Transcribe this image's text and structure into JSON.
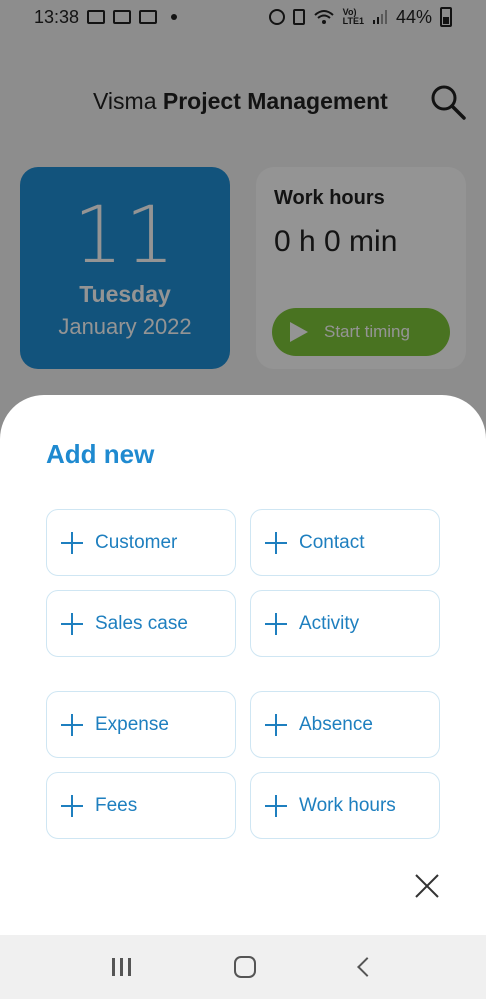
{
  "status_bar": {
    "time": "13:38",
    "battery": "44%"
  },
  "header": {
    "brand_light": "Visma",
    "brand_bold": "Project Management",
    "search_icon": "search-icon"
  },
  "date_card": {
    "day": "11",
    "weekday": "Tuesday",
    "month_year": "January 2022"
  },
  "work_card": {
    "title": "Work hours",
    "value": "0 h 0 min",
    "start_label": "Start timing"
  },
  "sheet": {
    "title": "Add new",
    "items": [
      {
        "label": "Customer"
      },
      {
        "label": "Contact"
      },
      {
        "label": "Sales case"
      },
      {
        "label": "Activity"
      },
      {
        "label": "Expense"
      },
      {
        "label": "Absence"
      },
      {
        "label": "Fees"
      },
      {
        "label": "Work hours"
      }
    ],
    "close_icon": "close-icon"
  },
  "colors": {
    "brand_blue": "#1f90d6",
    "action_blue": "#1e7fbf",
    "start_green": "#7fc63a"
  }
}
